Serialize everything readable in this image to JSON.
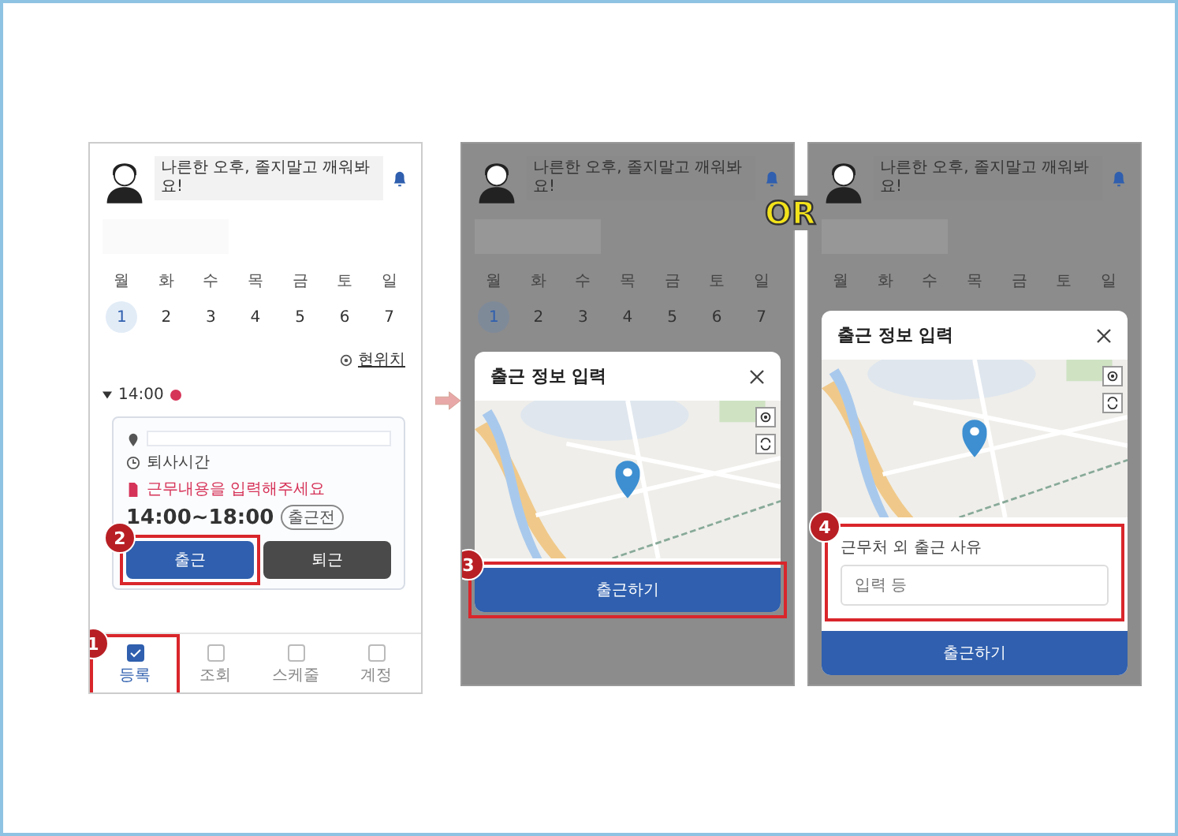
{
  "or_label": "OR",
  "screens": [
    {
      "kind": "main",
      "greeting": "나른한 오후, 졸지말고 깨워봐요!",
      "weekdays": [
        "월",
        "화",
        "수",
        "목",
        "금",
        "토",
        "일"
      ],
      "dates": [
        {
          "label": "1",
          "selected": true
        },
        {
          "label": "2",
          "selected": false
        },
        {
          "label": "3",
          "selected": false
        },
        {
          "label": "4",
          "selected": false
        },
        {
          "label": "5",
          "selected": false
        },
        {
          "label": "6",
          "selected": false
        },
        {
          "label": "7",
          "selected": false
        }
      ],
      "location_label": "현위치",
      "time_marker": "14:00",
      "card": {
        "clock_text": "퇴사시간",
        "notice": "근무내용을 입력해주세요",
        "time_range": "14:00~18:00",
        "status": "출근전"
      },
      "buttons": [
        {
          "label": "출근",
          "kind": "primary",
          "step": "2"
        },
        {
          "label": "퇴근",
          "kind": "dark"
        }
      ],
      "nav": [
        {
          "label": "등록",
          "selected": true,
          "step": "1"
        },
        {
          "label": "조회",
          "selected": false
        },
        {
          "label": "스케줄",
          "selected": false
        },
        {
          "label": "계정",
          "selected": false
        }
      ]
    },
    {
      "kind": "dialog",
      "greeting": "나른한 오후, 졸지말고 깨워봐요!",
      "weekdays": [
        "월",
        "화",
        "수",
        "목",
        "금",
        "토",
        "일"
      ],
      "dates": [
        {
          "label": "1",
          "selected": true
        },
        {
          "label": "2",
          "selected": false
        },
        {
          "label": "3",
          "selected": false
        },
        {
          "label": "4",
          "selected": false
        },
        {
          "label": "5",
          "selected": false
        },
        {
          "label": "6",
          "selected": false
        },
        {
          "label": "7",
          "selected": false
        }
      ],
      "dialog": {
        "title": "출근 정보 입력",
        "submit": {
          "label": "출근하기",
          "step": "3"
        }
      }
    },
    {
      "kind": "dialog",
      "greeting": "나른한 오후, 졸지말고 깨워봐요!",
      "weekdays": [
        "월",
        "화",
        "수",
        "목",
        "금",
        "토",
        "일"
      ],
      "dialog": {
        "title": "출근 정보 입력",
        "reason": {
          "label": "근무처 외 출근 사유",
          "placeholder": "입력 등",
          "step": "4"
        },
        "submit": {
          "label": "출근하기"
        }
      }
    }
  ]
}
